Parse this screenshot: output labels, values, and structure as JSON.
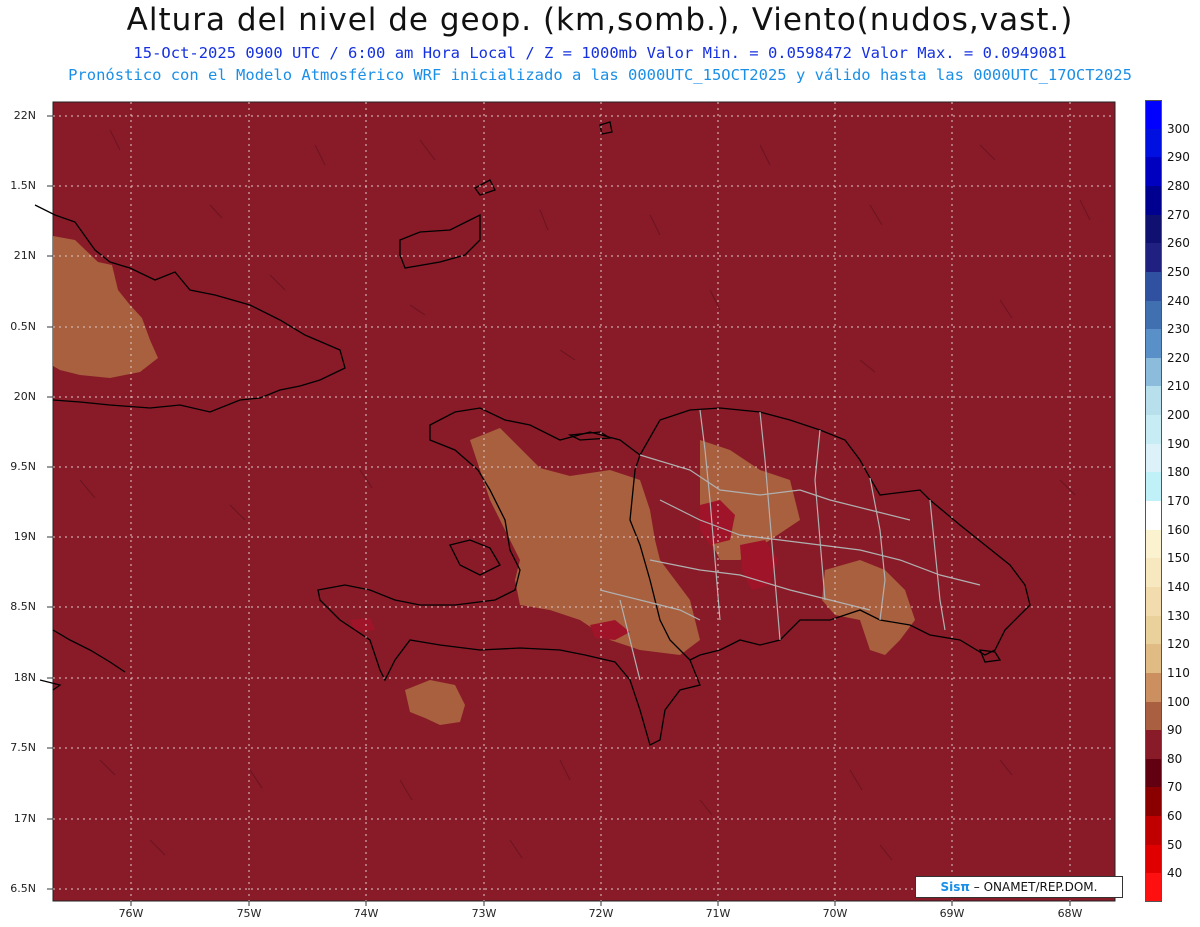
{
  "title": "Altura del nivel de geop. (km,somb.), Viento(nudos,vast.)",
  "subtitle_line1": "15-Oct-2025  0900 UTC / 6:00 am Hora Local / Z = 1000mb Valor Min. = 0.0598472  Valor Max. = 0.0949081",
  "subtitle_line2": "Pronóstico con el Modelo Atmosférico WRF inicializado a las 0000UTC_15OCT2025 y válido hasta las  0000UTC_17OCT2025",
  "latitude_labels": [
    "22N",
    "1.5N",
    "21N",
    "0.5N",
    "20N",
    "9.5N",
    "19N",
    "8.5N",
    "18N",
    "7.5N",
    "17N",
    "6.5N"
  ],
  "longitude_labels": [
    "76W",
    "75W",
    "74W",
    "73W",
    "72W",
    "71W",
    "70W",
    "69W",
    "68W"
  ],
  "legend": {
    "labels": [
      "300",
      "290",
      "280",
      "270",
      "260",
      "250",
      "240",
      "230",
      "220",
      "210",
      "200",
      "190",
      "180",
      "170",
      "160",
      "150",
      "140",
      "130",
      "120",
      "110",
      "100",
      "90",
      "80",
      "70",
      "60",
      "50",
      "40"
    ],
    "colors": [
      "#0000ff",
      "#0010e0",
      "#0000c0",
      "#000090",
      "#101070",
      "#202080",
      "#3050a0",
      "#4070b0",
      "#5a90c8",
      "#8cbcdc",
      "#b8e0ec",
      "#c8ecf4",
      "#dcf2f8",
      "#c0f0f8",
      "#ffffff",
      "#fbf2d0",
      "#f7e8c0",
      "#f2dcae",
      "#ead09a",
      "#e0bc84",
      "#cc9060",
      "#a86040",
      "#891b28",
      "#600010",
      "#8a0000",
      "#c00000",
      "#e00000",
      "#ff1010"
    ]
  },
  "credit": {
    "brand": "Sisπ",
    "separator": " – ",
    "org": "ONAMET/REP.DOM."
  },
  "colors": {
    "background_field": "#891b28",
    "low_anomaly": "#a8603e",
    "deep": "#a0142a",
    "border": "#000000",
    "province": "#b0b0b0"
  }
}
